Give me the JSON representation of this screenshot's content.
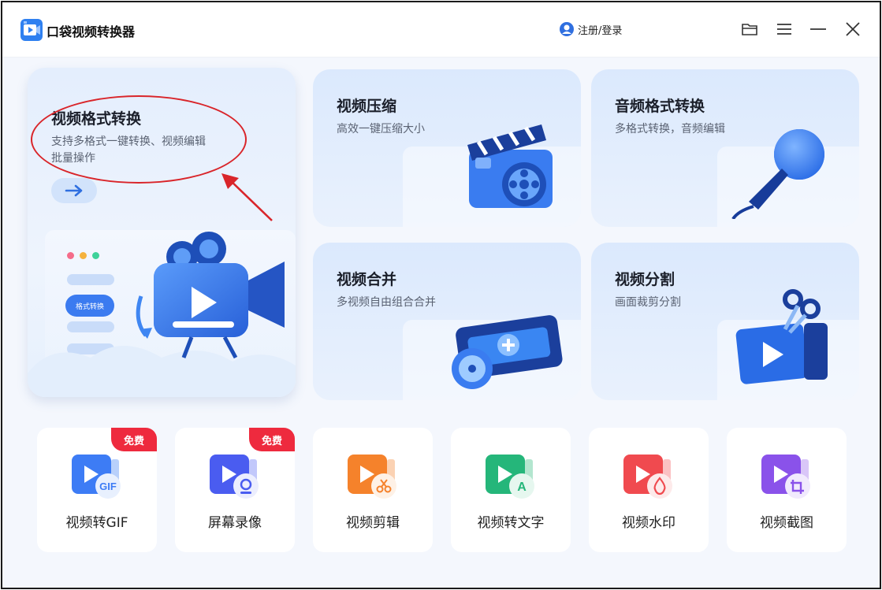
{
  "app": {
    "title": "口袋视频转换器",
    "login_label": "注册/登录"
  },
  "titlebar_icons": [
    "folder-icon",
    "menu-icon",
    "minimize-icon",
    "close-icon"
  ],
  "feature_cards": {
    "format_convert": {
      "title": "视频格式转换",
      "subtitle_line1": "支持多格式一键转换、视频编辑",
      "subtitle_line2": "批量操作",
      "mock_label": "格式转换"
    },
    "compress": {
      "title": "视频压缩",
      "subtitle": "高效一键压缩大小"
    },
    "audio_convert": {
      "title": "音频格式转换",
      "subtitle": "多格式转换，音频编辑"
    },
    "merge": {
      "title": "视频合并",
      "subtitle": "多视频自由组合合并"
    },
    "split": {
      "title": "视频分割",
      "subtitle": "画面裁剪分割"
    }
  },
  "tools": [
    {
      "label": "视频转GIF",
      "badge": "免费",
      "icon": "gif-icon",
      "color": "#3d7cf5"
    },
    {
      "label": "屏幕录像",
      "badge": "免费",
      "icon": "webcam-icon",
      "color": "#4a5cf0"
    },
    {
      "label": "视频剪辑",
      "badge": "",
      "icon": "scissors-icon",
      "color": "#f5822b"
    },
    {
      "label": "视频转文字",
      "badge": "",
      "icon": "text-a-icon",
      "color": "#25b67a"
    },
    {
      "label": "视频水印",
      "badge": "",
      "icon": "droplet-icon",
      "color": "#f04a4f"
    },
    {
      "label": "视频截图",
      "badge": "",
      "icon": "crop-icon",
      "color": "#8a52ea"
    }
  ],
  "colors": {
    "accent": "#3b7bf0",
    "badge_red": "#ee2a3e",
    "annotation_red": "#d9252a"
  }
}
